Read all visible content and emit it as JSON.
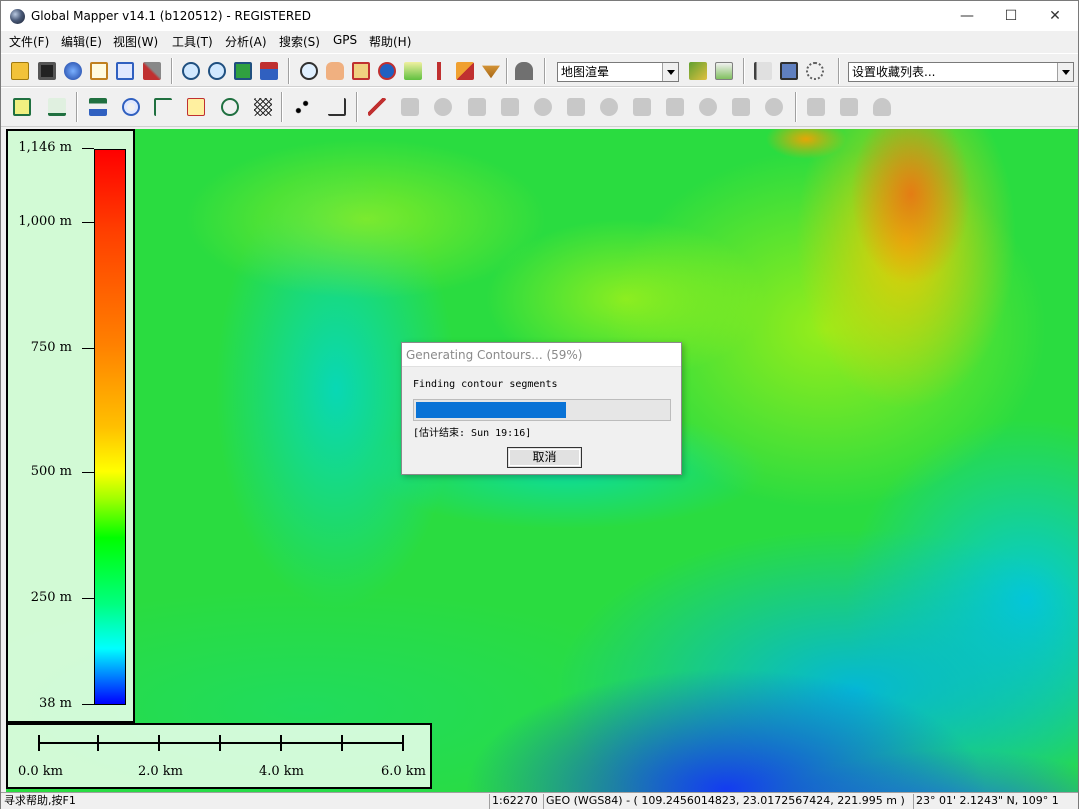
{
  "window": {
    "title": "Global Mapper v14.1 (b120512) - REGISTERED",
    "min_glyph": "—",
    "max_glyph": "☐",
    "close_glyph": "✕"
  },
  "menu": [
    "文件(F)",
    "编辑(E)",
    "视图(W)",
    "工具(T)",
    "分析(A)",
    "搜索(S)",
    "GPS",
    "帮助(H)"
  ],
  "toolbar": {
    "shader_combo": "地图渲晕",
    "favorites_combo": "设置收藏列表..."
  },
  "legend": {
    "labels": [
      "1,146 m",
      "1,000 m",
      "750 m",
      "500 m",
      "250 m",
      "38 m"
    ]
  },
  "scale": {
    "labels": [
      "0.0 km",
      "2.0 km",
      "4.0 km",
      "6.0 km"
    ]
  },
  "dialog": {
    "title": "Generating Contours... (59%)",
    "message": "Finding contour segments",
    "progress": 0.59,
    "eta": "[估计结束: Sun 19:16]",
    "cancel_label": "取消"
  },
  "statusbar": {
    "help": "寻求帮助,按F1",
    "scale": "1:62270",
    "coords": "GEO (WGS84) - ( 109.2456014823, 23.0172567424, 221.995 m )",
    "dms": "23° 01' 2.1243\" N, 109° 1"
  },
  "colors": {
    "progress_fill": "#0a73d6",
    "accent": "#0a73d6"
  }
}
